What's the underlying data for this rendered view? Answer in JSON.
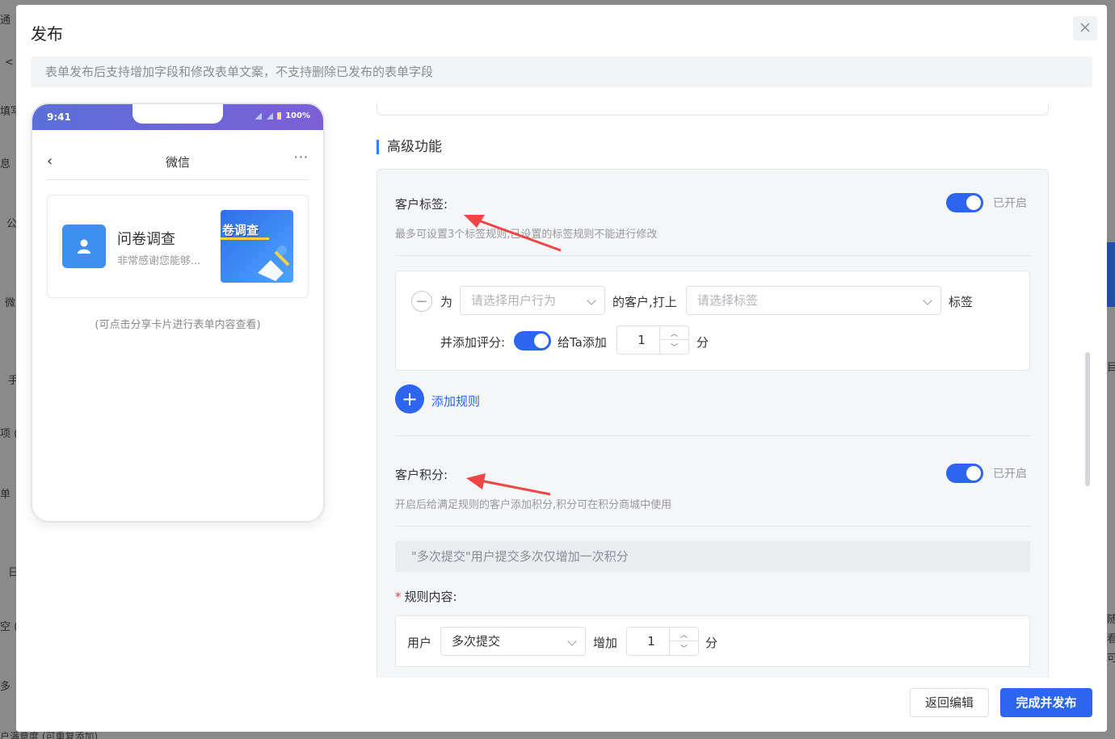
{
  "background": {
    "fragments": [
      "通",
      "<",
      "填写",
      "息",
      "公",
      "微",
      "手",
      "项 (",
      "单",
      "日",
      "空 (",
      "多",
      "户满意度 (可重复添加)",
      "目",
      "随,",
      "看",
      "可"
    ]
  },
  "dialog": {
    "title": "发布",
    "close_icon": "close-icon",
    "notice": "表单发布后支持增加字段和修改表单文案，不支持删除已发布的表单字段"
  },
  "phone": {
    "time": "9:41",
    "battery": "100%",
    "nav_title": "微信",
    "nav_back": "‹",
    "nav_more": "···",
    "card": {
      "title": "问卷调查",
      "desc": "非常感谢您能够...",
      "thumb_text": "卷调查"
    },
    "hint": "(可点击分享卡片进行表单内容查看)"
  },
  "advanced": {
    "section_title": "高级功能",
    "tag": {
      "label": "客户标签:",
      "desc": "最多可设置3个标签规则,已设置的标签规则不能进行修改",
      "status": "已开启",
      "enabled": true,
      "rule": {
        "prefix": "为",
        "behavior_placeholder": "请选择用户行为",
        "middle": "的客户,打上",
        "tag_placeholder": "请选择标签",
        "suffix": "标签",
        "score_label": "并添加评分:",
        "score_enabled": true,
        "give_label": "给Ta添加",
        "score_value": "1",
        "unit": "分"
      },
      "add_rule": "添加规则"
    },
    "points": {
      "label": "客户积分:",
      "desc": "开启后给满足规则的客户添加积分,积分可在积分商城中使用",
      "status": "已开启",
      "enabled": true,
      "notice": "\"多次提交\"用户提交多次仅增加一次积分",
      "rule_label": "规则内容:",
      "required_mark": "*",
      "rule": {
        "user": "用户",
        "action": "多次提交",
        "increase": "增加",
        "value": "1",
        "unit": "分"
      }
    }
  },
  "footer": {
    "back_label": "返回编辑",
    "publish_label": "完成并发布"
  },
  "colors": {
    "primary": "#2c66f0",
    "annotation_arrow": "#f04545"
  }
}
